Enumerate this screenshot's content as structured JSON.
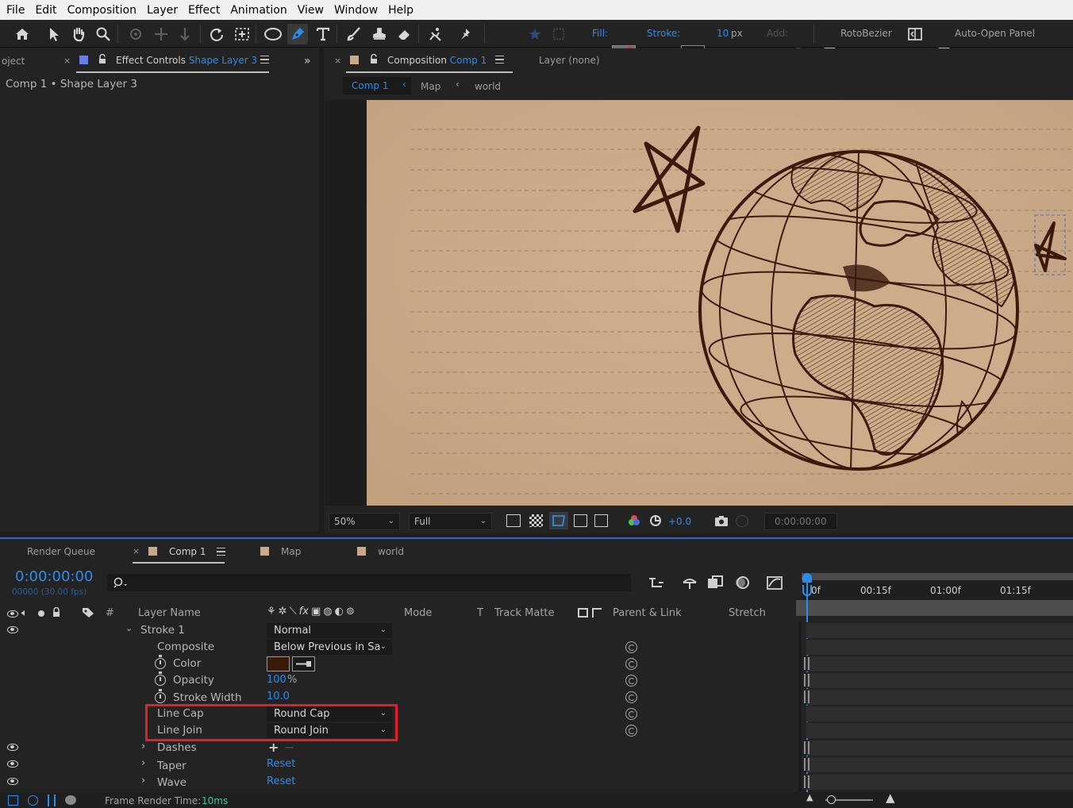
{
  "menu": [
    "File",
    "Edit",
    "Composition",
    "Layer",
    "Effect",
    "Animation",
    "View",
    "Window",
    "Help"
  ],
  "toolbar": {
    "tools": [
      "home-icon",
      "selection-arrow-icon",
      "hand-icon",
      "zoom-icon",
      "orbit-camera-icon",
      "pan-camera-icon",
      "dolly-camera-icon",
      "rotate-icon",
      "pan-behind-icon",
      "ellipse-icon",
      "pen-icon",
      "type-icon",
      "brush-icon",
      "clone-stamp-icon",
      "eraser-icon",
      "roto-brush-icon",
      "puppet-pin-icon"
    ],
    "fill_label": "Fill:",
    "stroke_label": "Stroke:",
    "stroke_width": "10",
    "stroke_unit": "px",
    "add_label": "Add:",
    "rotobezier_label": "RotoBezier",
    "rotobezier_checked": false,
    "autoopen_label": "Auto-Open Panel",
    "autoopen_checked": true,
    "stroke_color": "#3b1a0c"
  },
  "project_panel": {
    "project_tab": "oject",
    "effect_controls_label": "Effect Controls",
    "effect_controls_target": "Shape Layer 3",
    "breadcrumb": "Comp 1 • Shape Layer 3"
  },
  "composition_panel": {
    "tab_label": "Composition",
    "tab_target": "Comp 1",
    "layer_tab": "Layer (none)",
    "flow": [
      "Comp 1",
      "Map",
      "world"
    ],
    "zoom": "50%",
    "resolution": "Full",
    "exposure": "+0.0",
    "timecode": "0:00:00:00"
  },
  "timeline": {
    "tabs": [
      "Render Queue",
      "Comp 1",
      "Map",
      "world"
    ],
    "current_time": "0:00:00:00",
    "frame_info": "00000 (30.00 fps)",
    "ruler": [
      "0f",
      "00:15f",
      "01:00f",
      "01:15f"
    ],
    "columns": {
      "hash": "#",
      "layer_name": "Layer Name",
      "mode": "Mode",
      "t": "T",
      "track_matte": "Track Matte",
      "parent": "Parent & Link",
      "stretch": "Stretch"
    },
    "rows": {
      "stroke": {
        "label": "Stroke 1",
        "mode": "Normal"
      },
      "composite": {
        "label": "Composite",
        "value": "Below Previous in Sa"
      },
      "color": {
        "label": "Color",
        "color": "#3b1a0c"
      },
      "opacity": {
        "label": "Opacity",
        "value": "100",
        "unit": "%"
      },
      "stroke_width": {
        "label": "Stroke Width",
        "value": "10.0"
      },
      "line_cap": {
        "label": "Line Cap",
        "value": "Round Cap"
      },
      "line_join": {
        "label": "Line Join",
        "value": "Round Join"
      },
      "dashes": {
        "label": "Dashes"
      },
      "taper": {
        "label": "Taper",
        "value": "Reset"
      },
      "wave": {
        "label": "Wave",
        "value": "Reset"
      }
    },
    "render_time_label": "Frame Render Time:",
    "render_time_value": "10ms"
  },
  "colors": {
    "accent": "#2d8ceb",
    "highlight_box": "#e0202a",
    "paper": "#c9a987",
    "ink": "#3b1a0c"
  }
}
